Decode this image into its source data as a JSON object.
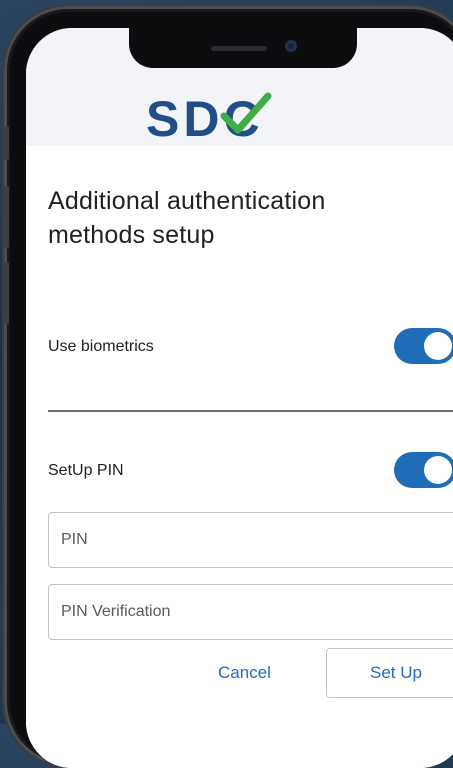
{
  "header": {
    "logo_text": "SDC",
    "brand_color": "#1f4f86",
    "check_color": "#3fae49"
  },
  "form": {
    "title": "Additional authentication methods setup",
    "biometrics": {
      "label": "Use biometrics",
      "enabled": true
    },
    "pin": {
      "label": "SetUp PIN",
      "enabled": true
    },
    "pin_field": {
      "placeholder": "PIN",
      "value": ""
    },
    "pin_verification_field": {
      "placeholder": "PIN Verification",
      "value": ""
    },
    "cancel_label": "Cancel",
    "setup_label": "Set Up",
    "accent_color": "#1f6db7"
  }
}
